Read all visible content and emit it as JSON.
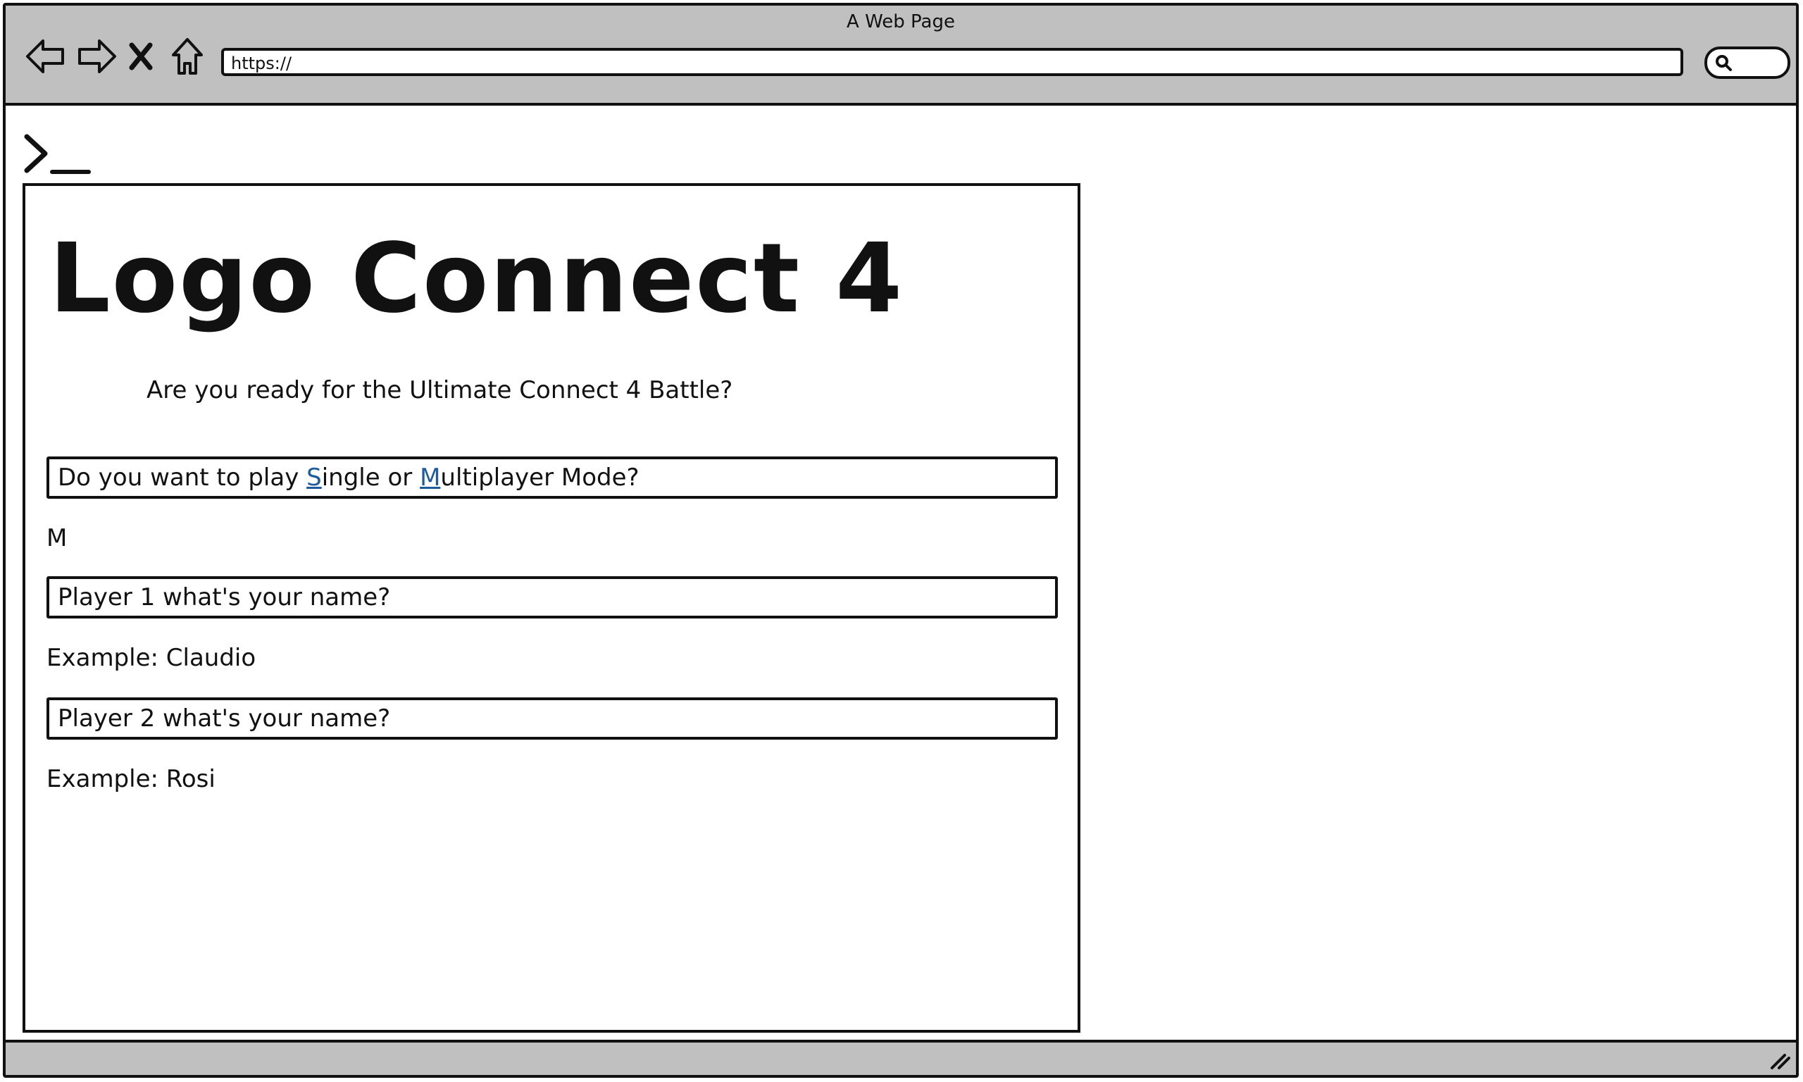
{
  "browser": {
    "title": "A Web Page",
    "url": "https://",
    "icons": {
      "back": "back-arrow-icon",
      "forward": "forward-arrow-icon",
      "stop": "close-icon",
      "home": "home-icon",
      "search": "search-icon",
      "terminal": "terminal-prompt-icon",
      "resize": "resize-grip-icon"
    }
  },
  "page": {
    "logo_title": "Logo Connect 4",
    "tagline": "Are you ready for the Ultimate Connect 4 Battle?",
    "mode_question": {
      "prefix": "Do you want to play ",
      "single_key": "S",
      "single_rest": "ingle or ",
      "multi_key": "M",
      "multi_rest": "ultiplayer Mode?"
    },
    "mode_answer": "M",
    "player1_question": "Player 1 what's your name?",
    "player1_example": "Example: Claudio",
    "player2_question": "Player 2 what's your name?",
    "player2_example": "Example: Rosi"
  },
  "colors": {
    "chrome": "#c0c0c0",
    "link": "#1e5a9e"
  }
}
